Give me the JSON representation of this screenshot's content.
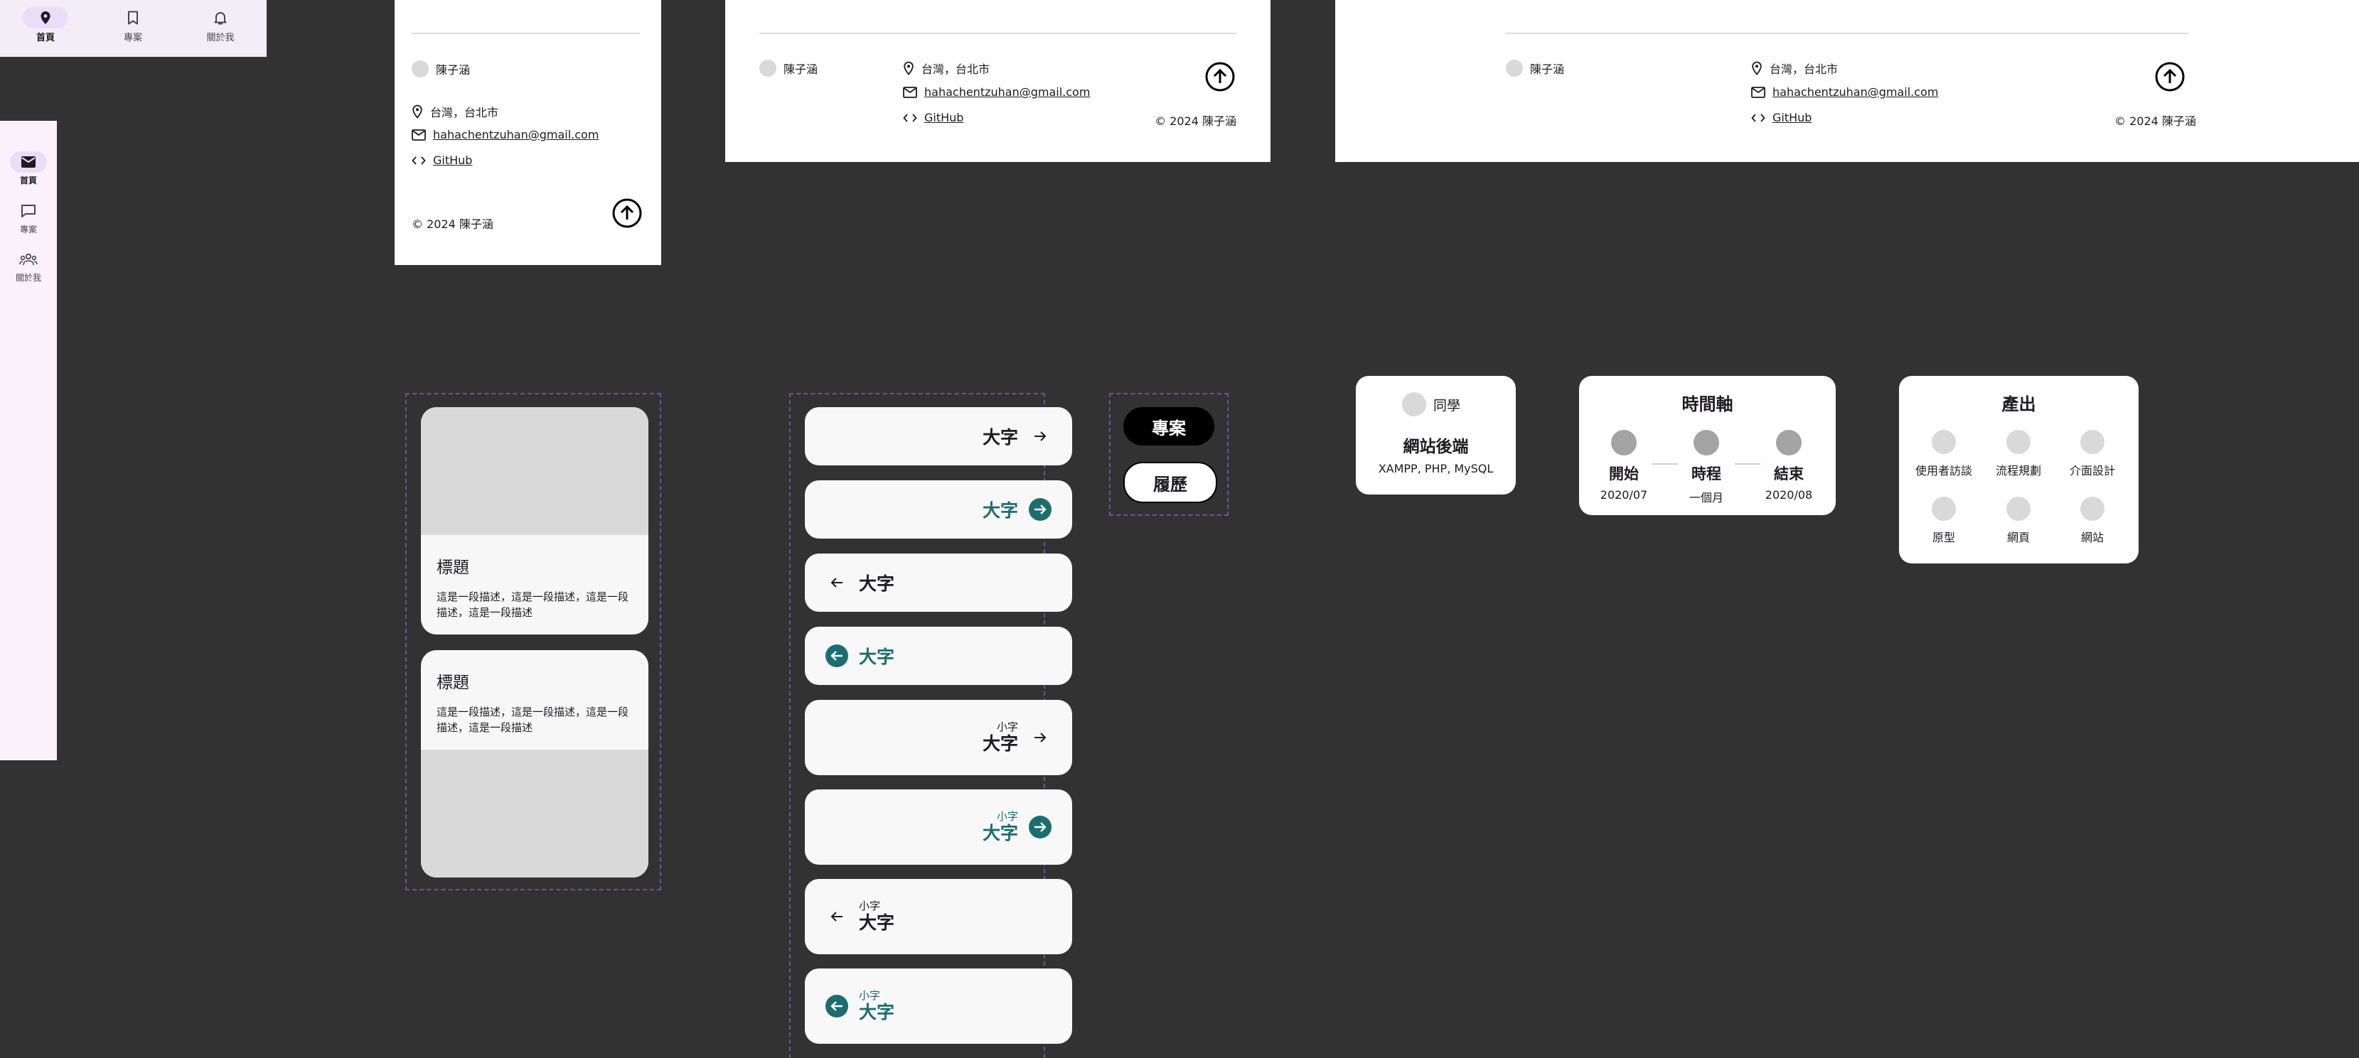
{
  "bottom_nav": {
    "items": [
      {
        "label": "首頁",
        "icon": "location-pin-icon"
      },
      {
        "label": "專案",
        "icon": "bookmark-icon"
      },
      {
        "label": "關於我",
        "icon": "bell-icon"
      }
    ]
  },
  "nav_rail": {
    "items": [
      {
        "label": "首頁",
        "icon": "mail-icon"
      },
      {
        "label": "專案",
        "icon": "chat-bubble-icon"
      },
      {
        "label": "關於我",
        "icon": "people-icon"
      }
    ]
  },
  "footer": {
    "name": "陳子涵",
    "location": "台灣，台北市",
    "email": "hahachentzuhan@gmail.com",
    "github": "GitHub",
    "copyright": "© 2024 陳子涵"
  },
  "cards": [
    {
      "title": "標題",
      "description": "這是一段描述，這是一段描述，這是一段描述，這是一段描述"
    },
    {
      "title": "標題",
      "description": "這是一段描述，這是一段描述，這是一段描述，這是一段描述"
    }
  ],
  "link_buttons": {
    "big": "大字",
    "small": "小字"
  },
  "toggle_buttons": {
    "projects": "專案",
    "resume": "履歷"
  },
  "role_card": {
    "tag": "同學",
    "title": "網站後端",
    "stack": "XAMPP, PHP, MySQL"
  },
  "timeline_card": {
    "title": "時間軸",
    "items": [
      {
        "label": "開始",
        "value": "2020/07"
      },
      {
        "label": "時程",
        "value": "一個月"
      },
      {
        "label": "結束",
        "value": "2020/08"
      }
    ]
  },
  "output_card": {
    "title": "產出",
    "items": [
      "使用者訪談",
      "流程規劃",
      "介面設計",
      "原型",
      "網頁",
      "網站"
    ]
  },
  "colors": {
    "background": "#323232",
    "accent_teal": "#1d6d70",
    "nav_active": "#e8def8"
  }
}
